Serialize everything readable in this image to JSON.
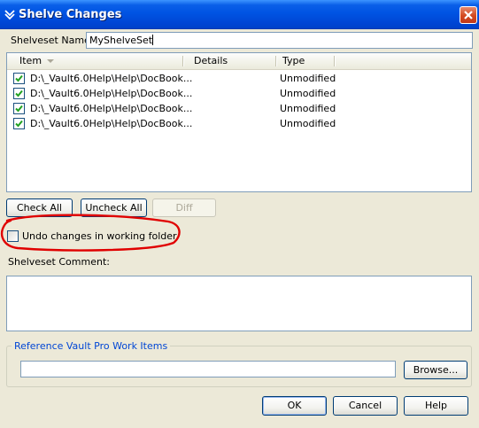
{
  "window": {
    "title": "Shelve Changes",
    "menu_icon": "chevron-down-icon",
    "close_icon": "close-icon"
  },
  "shelveset_name": {
    "label": "Shelveset Name:",
    "value": "MyShelveSet"
  },
  "items_list": {
    "columns": [
      "Item",
      "Details",
      "Type"
    ],
    "rows": [
      {
        "checked": true,
        "item": "D:\\_Vault6.0Help\\Help\\DocBook...",
        "details": "",
        "type": "Unmodified"
      },
      {
        "checked": true,
        "item": "D:\\_Vault6.0Help\\Help\\DocBook...",
        "details": "",
        "type": "Unmodified"
      },
      {
        "checked": true,
        "item": "D:\\_Vault6.0Help\\Help\\DocBook...",
        "details": "",
        "type": "Unmodified"
      },
      {
        "checked": true,
        "item": "D:\\_Vault6.0Help\\Help\\DocBook...",
        "details": "",
        "type": "Unmodified"
      }
    ]
  },
  "buttons": {
    "check_all": "Check All",
    "uncheck_all": "Uncheck All",
    "diff": "Diff",
    "browse": "Browse...",
    "ok": "OK",
    "cancel": "Cancel",
    "help": "Help"
  },
  "undo_changes": {
    "label": "Undo changes in working folder",
    "checked": false
  },
  "comment": {
    "label": "Shelveset Comment:",
    "value": ""
  },
  "work_items": {
    "legend": "Reference Vault Pro Work Items",
    "value": ""
  },
  "colors": {
    "title_bar": "#0054e3",
    "annotation": "#e00000",
    "legend_text": "#0046d5",
    "face": "#ece9d8"
  }
}
